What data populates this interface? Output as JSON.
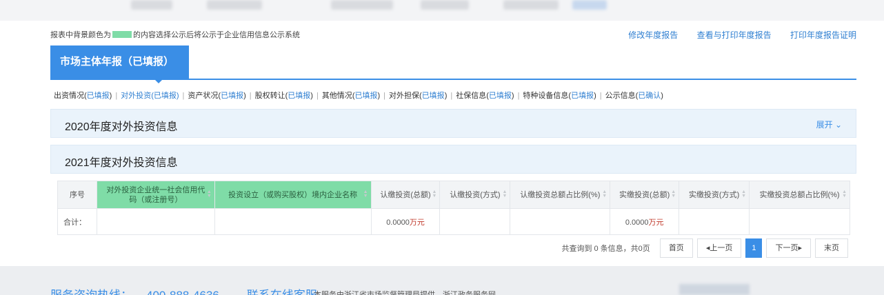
{
  "notice": {
    "prefix": "报表中背景颜色为",
    "suffix": "的内容选择公示后将公示于企业信用信息公示系统"
  },
  "top_links": [
    "修改年度报告",
    "查看与打印年度报告",
    "打印年度报告证明"
  ],
  "main_tab": "市场主体年报（已填报）",
  "sub_tabs": [
    {
      "name": "出资情况",
      "status": "已填报"
    },
    {
      "name": "对外投资",
      "status": "已填报"
    },
    {
      "name": "资产状况",
      "status": "已填报"
    },
    {
      "name": "股权转让",
      "status": "已填报"
    },
    {
      "name": "其他情况",
      "status": "已填报"
    },
    {
      "name": "对外担保",
      "status": "已填报"
    },
    {
      "name": "社保信息",
      "status": "已填报"
    },
    {
      "name": "特种设备信息",
      "status": "已填报"
    },
    {
      "name": "公示信息",
      "status": "已确认"
    }
  ],
  "panel_2020": {
    "title": "2020年度对外投资信息",
    "expand": "展开"
  },
  "panel_2021": {
    "title": "2021年度对外投资信息"
  },
  "table": {
    "headers": [
      "序号",
      "对外投资企业统一社会信用代码（或注册号）",
      "投资设立（或购买股权）境内企业名称",
      "认缴投资(总额)",
      "认缴投资(方式)",
      "认缴投资总额占比例(%)",
      "实缴投资(总额)",
      "实缴投资(方式)",
      "实缴投资总额占比例(%)"
    ],
    "total_label": "合计：",
    "subscribed_total": "0.0000",
    "paid_total": "0.0000",
    "unit": "万元"
  },
  "pager": {
    "info": "共查询到 0 条信息，共0页",
    "first": "首页",
    "prev": "上一页",
    "current": "1",
    "next": "下一页",
    "last": "末页"
  },
  "footer": {
    "hotline_label": "服务咨询热线：",
    "hotline_number": "400-888-4636",
    "online_service": "联系在线客服",
    "note": "本服务由浙江省市场监督管理局提供，浙江政务服务网"
  }
}
